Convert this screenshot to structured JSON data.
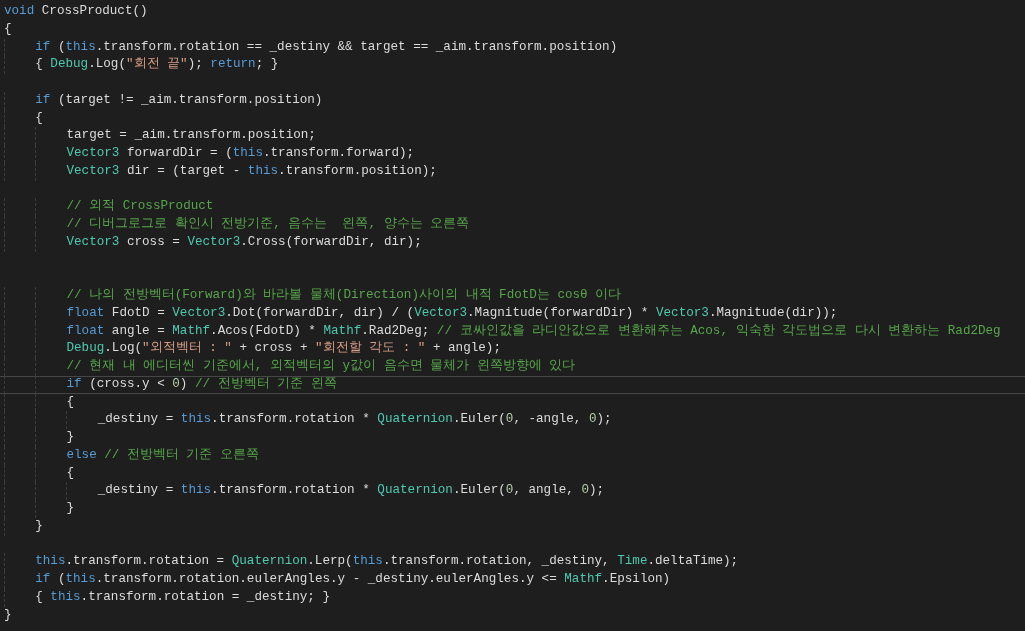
{
  "editor": {
    "lines": [
      {
        "kind": "code",
        "current": false,
        "tokens": [
          {
            "kind": "keyword",
            "text": "void"
          },
          {
            "kind": "plain",
            "text": " CrossProduct()"
          }
        ]
      },
      {
        "kind": "code",
        "current": false,
        "tokens": [
          {
            "kind": "plain",
            "text": "{"
          }
        ]
      },
      {
        "kind": "code",
        "current": false,
        "tokens": [
          {
            "kind": "keyword",
            "text": "    if"
          },
          {
            "kind": "plain",
            "text": " ("
          },
          {
            "kind": "keyword",
            "text": "this"
          },
          {
            "kind": "plain",
            "text": ".transform.rotation == _destiny && target == _aim.transform.position)"
          }
        ]
      },
      {
        "kind": "code",
        "current": false,
        "tokens": [
          {
            "kind": "plain",
            "text": "    { "
          },
          {
            "kind": "type",
            "text": "Debug"
          },
          {
            "kind": "plain",
            "text": ".Log("
          },
          {
            "kind": "string",
            "text": "\"회전 끝\""
          },
          {
            "kind": "plain",
            "text": "); "
          },
          {
            "kind": "keyword",
            "text": "return"
          },
          {
            "kind": "plain",
            "text": "; }"
          }
        ]
      },
      {
        "kind": "blank"
      },
      {
        "kind": "code",
        "current": false,
        "tokens": [
          {
            "kind": "keyword",
            "text": "    if"
          },
          {
            "kind": "plain",
            "text": " (target != _aim.transform.position)"
          }
        ]
      },
      {
        "kind": "code",
        "current": false,
        "tokens": [
          {
            "kind": "plain",
            "text": "    {"
          }
        ]
      },
      {
        "kind": "code",
        "current": false,
        "tokens": [
          {
            "kind": "plain",
            "text": "        target = _aim.transform.position;"
          }
        ]
      },
      {
        "kind": "code",
        "current": false,
        "tokens": [
          {
            "kind": "type",
            "text": "        Vector3"
          },
          {
            "kind": "plain",
            "text": " forwardDir = ("
          },
          {
            "kind": "keyword",
            "text": "this"
          },
          {
            "kind": "plain",
            "text": ".transform.forward);"
          }
        ]
      },
      {
        "kind": "code",
        "current": false,
        "tokens": [
          {
            "kind": "type",
            "text": "        Vector3"
          },
          {
            "kind": "plain",
            "text": " dir = (target - "
          },
          {
            "kind": "keyword",
            "text": "this"
          },
          {
            "kind": "plain",
            "text": ".transform.position);"
          }
        ]
      },
      {
        "kind": "blank"
      },
      {
        "kind": "code",
        "current": false,
        "tokens": [
          {
            "kind": "comment",
            "text": "        // 외적 CrossProduct"
          }
        ]
      },
      {
        "kind": "code",
        "current": false,
        "tokens": [
          {
            "kind": "comment",
            "text": "        // 디버그로그로 확인시 전방기준, 음수는  왼쪽, 양수는 오른쪽"
          }
        ]
      },
      {
        "kind": "code",
        "current": false,
        "tokens": [
          {
            "kind": "type",
            "text": "        Vector3"
          },
          {
            "kind": "plain",
            "text": " cross = "
          },
          {
            "kind": "type",
            "text": "Vector3"
          },
          {
            "kind": "plain",
            "text": ".Cross(forwardDir, dir);"
          }
        ]
      },
      {
        "kind": "blank"
      },
      {
        "kind": "blank"
      },
      {
        "kind": "code",
        "current": false,
        "tokens": [
          {
            "kind": "comment",
            "text": "        // 나의 전방벡터(Forward)와 바라볼 물체(Direction)사이의 내적 FdotD는 cosθ 이다"
          }
        ]
      },
      {
        "kind": "code",
        "current": false,
        "tokens": [
          {
            "kind": "keyword",
            "text": "        float"
          },
          {
            "kind": "plain",
            "text": " FdotD = "
          },
          {
            "kind": "type",
            "text": "Vector3"
          },
          {
            "kind": "plain",
            "text": ".Dot(forwardDir, dir) / ("
          },
          {
            "kind": "type",
            "text": "Vector3"
          },
          {
            "kind": "plain",
            "text": ".Magnitude(forwardDir) * "
          },
          {
            "kind": "type",
            "text": "Vector3"
          },
          {
            "kind": "plain",
            "text": ".Magnitude(dir));"
          }
        ]
      },
      {
        "kind": "code",
        "current": false,
        "tokens": [
          {
            "kind": "keyword",
            "text": "        float"
          },
          {
            "kind": "plain",
            "text": " angle = "
          },
          {
            "kind": "type",
            "text": "Mathf"
          },
          {
            "kind": "plain",
            "text": ".Acos(FdotD) * "
          },
          {
            "kind": "type",
            "text": "Mathf"
          },
          {
            "kind": "plain",
            "text": ".Rad2Deg; "
          },
          {
            "kind": "comment",
            "text": "// 코싸인값을 라디안값으로 변환해주는 Acos, 익숙한 각도법으로 다시 변환하는 Rad2Deg"
          }
        ]
      },
      {
        "kind": "code",
        "current": false,
        "tokens": [
          {
            "kind": "type",
            "text": "        Debug"
          },
          {
            "kind": "plain",
            "text": ".Log("
          },
          {
            "kind": "string",
            "text": "\"외적벡터 : \""
          },
          {
            "kind": "plain",
            "text": " + cross + "
          },
          {
            "kind": "string",
            "text": "\"회전할 각도 : \""
          },
          {
            "kind": "plain",
            "text": " + angle);"
          }
        ]
      },
      {
        "kind": "code",
        "current": false,
        "tokens": [
          {
            "kind": "comment",
            "text": "        // 현재 내 에디터씬 기준에서, 외적벡터의 y값이 음수면 물체가 왼쪽방향에 있다"
          }
        ]
      },
      {
        "kind": "code",
        "current": true,
        "tokens": [
          {
            "kind": "keyword",
            "text": "        if"
          },
          {
            "kind": "plain",
            "text": " (cross.y < "
          },
          {
            "kind": "number",
            "text": "0"
          },
          {
            "kind": "plain",
            "text": ") "
          },
          {
            "kind": "comment",
            "text": "// 전방벡터 기준 왼쪽"
          }
        ]
      },
      {
        "kind": "code",
        "current": false,
        "tokens": [
          {
            "kind": "plain",
            "text": "        {"
          }
        ]
      },
      {
        "kind": "code",
        "current": false,
        "tokens": [
          {
            "kind": "plain",
            "text": "            _destiny = "
          },
          {
            "kind": "keyword",
            "text": "this"
          },
          {
            "kind": "plain",
            "text": ".transform.rotation * "
          },
          {
            "kind": "type",
            "text": "Quaternion"
          },
          {
            "kind": "plain",
            "text": ".Euler("
          },
          {
            "kind": "number",
            "text": "0"
          },
          {
            "kind": "plain",
            "text": ", -angle, "
          },
          {
            "kind": "number",
            "text": "0"
          },
          {
            "kind": "plain",
            "text": ");"
          }
        ]
      },
      {
        "kind": "code",
        "current": false,
        "tokens": [
          {
            "kind": "plain",
            "text": "        }"
          }
        ]
      },
      {
        "kind": "code",
        "current": false,
        "tokens": [
          {
            "kind": "keyword",
            "text": "        else "
          },
          {
            "kind": "comment",
            "text": "// 전방벡터 기준 오른쪽"
          }
        ]
      },
      {
        "kind": "code",
        "current": false,
        "tokens": [
          {
            "kind": "plain",
            "text": "        {"
          }
        ]
      },
      {
        "kind": "code",
        "current": false,
        "tokens": [
          {
            "kind": "plain",
            "text": "            _destiny = "
          },
          {
            "kind": "keyword",
            "text": "this"
          },
          {
            "kind": "plain",
            "text": ".transform.rotation * "
          },
          {
            "kind": "type",
            "text": "Quaternion"
          },
          {
            "kind": "plain",
            "text": ".Euler("
          },
          {
            "kind": "number",
            "text": "0"
          },
          {
            "kind": "plain",
            "text": ", angle, "
          },
          {
            "kind": "number",
            "text": "0"
          },
          {
            "kind": "plain",
            "text": ");"
          }
        ]
      },
      {
        "kind": "code",
        "current": false,
        "tokens": [
          {
            "kind": "plain",
            "text": "        }"
          }
        ]
      },
      {
        "kind": "code",
        "current": false,
        "tokens": [
          {
            "kind": "plain",
            "text": "    }"
          }
        ]
      },
      {
        "kind": "blank"
      },
      {
        "kind": "code",
        "current": false,
        "tokens": [
          {
            "kind": "keyword",
            "text": "    this"
          },
          {
            "kind": "plain",
            "text": ".transform.rotation = "
          },
          {
            "kind": "type",
            "text": "Quaternion"
          },
          {
            "kind": "plain",
            "text": ".Lerp("
          },
          {
            "kind": "keyword",
            "text": "this"
          },
          {
            "kind": "plain",
            "text": ".transform.rotation, _destiny, "
          },
          {
            "kind": "type",
            "text": "Time"
          },
          {
            "kind": "plain",
            "text": ".deltaTime);"
          }
        ]
      },
      {
        "kind": "code",
        "current": false,
        "tokens": [
          {
            "kind": "keyword",
            "text": "    if"
          },
          {
            "kind": "plain",
            "text": " ("
          },
          {
            "kind": "keyword",
            "text": "this"
          },
          {
            "kind": "plain",
            "text": ".transform.rotation.eulerAngles.y - _destiny.eulerAngles.y <= "
          },
          {
            "kind": "type",
            "text": "Mathf"
          },
          {
            "kind": "plain",
            "text": ".Epsilon)"
          }
        ]
      },
      {
        "kind": "code",
        "current": false,
        "tokens": [
          {
            "kind": "plain",
            "text": "    { "
          },
          {
            "kind": "keyword",
            "text": "this"
          },
          {
            "kind": "plain",
            "text": ".transform.rotation = _destiny; }"
          }
        ]
      },
      {
        "kind": "code",
        "current": false,
        "tokens": [
          {
            "kind": "plain",
            "text": "}"
          }
        ]
      }
    ]
  }
}
